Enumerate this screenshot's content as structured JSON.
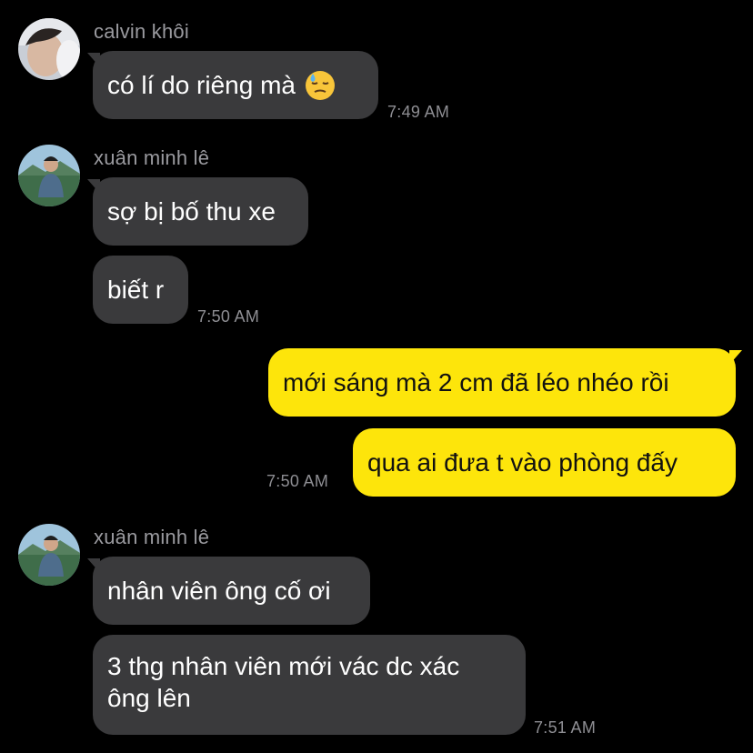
{
  "colors": {
    "background": "#000000",
    "incoming_bubble": "#3a3a3c",
    "outgoing_bubble": "#fde50b",
    "sender_name": "#9a9a9f",
    "timestamp": "#8e8e93"
  },
  "group1": {
    "sender": "calvin khôi",
    "message1": "có lí do riêng mà",
    "emoji_icon": "downcast-face-with-sweat-emoji",
    "time": "7:49 AM"
  },
  "group2": {
    "sender": "xuân minh lê",
    "message1": "sợ bị bố thu xe",
    "message2": "biết r",
    "time": "7:50 AM"
  },
  "group3": {
    "message1": "mới sáng mà 2 cm đã léo nhéo rồi",
    "message2": "qua ai đưa t vào phòng đấy",
    "time": "7:50 AM"
  },
  "group4": {
    "sender": "xuân minh lê",
    "message1": "nhân viên ông cố ơi",
    "message2_line1": "3 thg nhân viên mới vác dc xác",
    "message2_line2": "ông lên",
    "time": "7:51 AM"
  }
}
